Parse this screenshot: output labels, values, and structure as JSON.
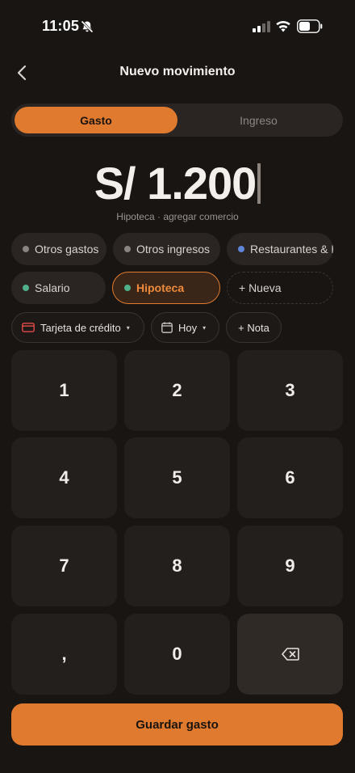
{
  "status_bar": {
    "time": "11:05"
  },
  "header": {
    "title": "Nuevo movimiento"
  },
  "segments": {
    "gasto": "Gasto",
    "ingreso": "Ingreso",
    "selected": "Gasto"
  },
  "amount": {
    "value": "S/ 1.200"
  },
  "subtitle": {
    "category": "Hipoteca",
    "separator": " · ",
    "action": "agregar comercio"
  },
  "categories": [
    {
      "label": "Otros gastos",
      "dot_color": "#8a8480"
    },
    {
      "label": "Otros ingresos",
      "dot_color": "#8a8480"
    },
    {
      "label": "Restaurantes & Bares",
      "dot_color": "#5f86d6"
    },
    {
      "label": "Salario",
      "dot_color": "#4fb08a"
    },
    {
      "label": "Hipoteca",
      "dot_color": "#4fb08a",
      "selected": true
    },
    {
      "label": "+ Nueva"
    }
  ],
  "pills": {
    "payment": "Tarjeta de crédito",
    "date": "Hoy",
    "note": "+ Nota"
  },
  "keypad": {
    "keys": [
      "1",
      "2",
      "3",
      "4",
      "5",
      "6",
      "7",
      "8",
      "9",
      ",",
      "0"
    ]
  },
  "actions": {
    "save": "Guardar gasto"
  },
  "colors": {
    "accent": "#e07a2e",
    "background": "#181513",
    "surface": "#231f1c"
  }
}
